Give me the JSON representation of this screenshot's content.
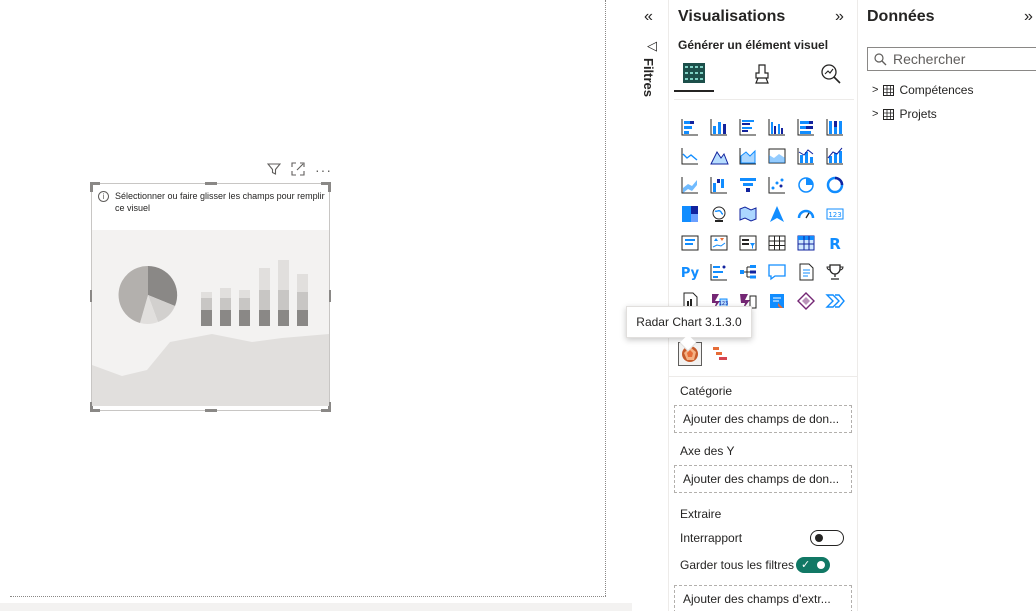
{
  "visual": {
    "message": "Sélectionner ou faire glisser les champs pour remplir ce visuel",
    "header_icons": [
      "filter-icon",
      "focus-mode-icon",
      "more-options-icon"
    ]
  },
  "filters_pane": {
    "label": "Filtres",
    "collapse_glyph": "«",
    "icon_glyph": "◁"
  },
  "viz_pane": {
    "title": "Visualisations",
    "expand_glyph": "»",
    "subtitle": "Générer un élément visuel",
    "tooltip": "Radar Chart 3.1.3.0",
    "r_label": "R",
    "py_label": "Py",
    "wells": {
      "category_label": "Catégorie",
      "category_placeholder": "Ajouter des champs de don...",
      "y_axis_label": "Axe des Y",
      "y_axis_placeholder": "Ajouter des champs de don...",
      "drillthrough_title": "Extraire",
      "cross_report_label": "Interrapport",
      "keep_filters_label": "Garder tous les filtres",
      "drillthrough_placeholder": "Ajouter des champs d'extr..."
    },
    "toggles": {
      "cross_report": false,
      "keep_filters": true
    }
  },
  "data_pane": {
    "title": "Données",
    "expand_glyph": "»",
    "search_placeholder": "Rechercher",
    "tables": [
      "Compétences",
      "Projets"
    ]
  },
  "colors": {
    "accent": "#117865",
    "text": "#252423",
    "border": "#8a8886",
    "power_bi_blue": "#118dff",
    "radar_orange": "#e66c37"
  }
}
